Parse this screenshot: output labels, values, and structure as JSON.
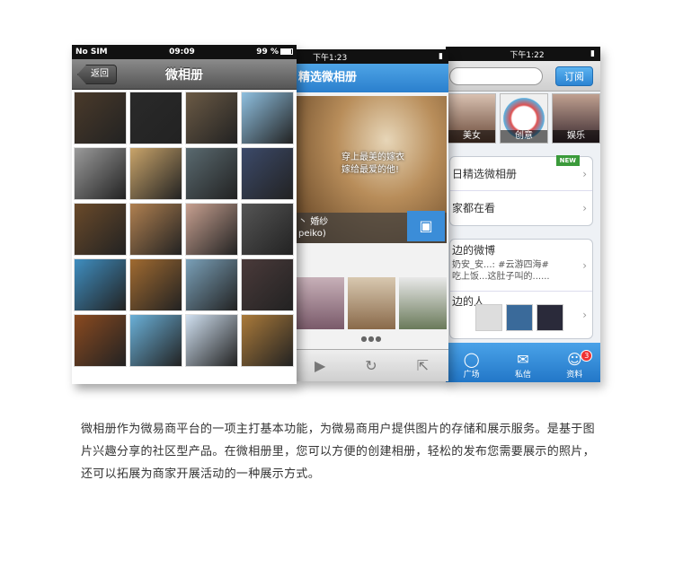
{
  "phone1": {
    "carrier": "No SIM",
    "time": "09:09",
    "battery": "99 %",
    "back_label": "返回",
    "title": "微相册",
    "thumb_colors": [
      "#4a3a2a",
      "#2a2a2a",
      "#6b5a45",
      "#8fc0e0",
      "#9a9a9a",
      "#c9a46a",
      "#5a6a70",
      "#3c4a6a",
      "#6a4a2a",
      "#b08050",
      "#c7a090",
      "#555555",
      "#3f8ec0",
      "#a06a30",
      "#7aa0b8",
      "#4a3a3a",
      "#8a4a20",
      "#6ab0d8",
      "#d0e0f0",
      "#aa7a3a"
    ]
  },
  "phone2": {
    "time": "下午1:23",
    "title": "精选微相册",
    "hero_caption_1": "穿上最美的嫁衣",
    "hero_caption_2": "嫁给最爱的他!",
    "album_name": "婚纱",
    "album_author": "peiko)",
    "pager": "●●●"
  },
  "phone3": {
    "time": "下午1:22",
    "subscribe_label": "订阅",
    "categories": [
      "美女",
      "创意",
      "娱乐"
    ],
    "row1_label": "日精选微相册",
    "new_badge": "NEW",
    "row2_label": "家都在看",
    "weibo_label": "边的微博",
    "weibo_sub_1": "奶安_安...: #云游四海#",
    "weibo_sub_2": "吃上饭...这肚子叫的......",
    "people_label": "边的人",
    "tabs": [
      "广场",
      "私信",
      "资料"
    ],
    "badge_count": "3"
  },
  "description": "微相册作为微易商平台的一项主打基本功能，为微易商用户提供图片的存储和展示服务。是基于图片兴趣分享的社区型产品。在微相册里，您可以方便的创建相册，轻松的发布您需要展示的照片，还可以拓展为商家开展活动的一种展示方式。"
}
